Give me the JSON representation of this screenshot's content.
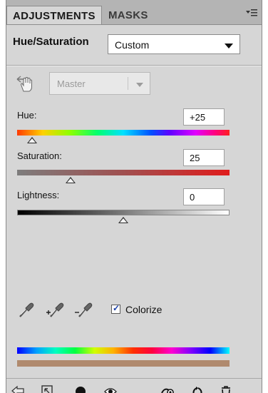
{
  "tabs": [
    {
      "label": "ADJUSTMENTS",
      "active": true
    },
    {
      "label": "MASKS",
      "active": false
    }
  ],
  "panel_menu_icon": "panel-menu-icon",
  "header": {
    "title": "Hue/Saturation",
    "preset": "Custom"
  },
  "channel": {
    "value": "Master",
    "enabled": false,
    "icon": "targeted-adjustment-hand-icon"
  },
  "sliders": {
    "hue": {
      "label": "Hue:",
      "value": "+25",
      "level": 0.07
    },
    "saturation": {
      "label": "Saturation:",
      "value": "25",
      "level": 0.25
    },
    "lightness": {
      "label": "Lightness:",
      "value": "0",
      "level": 0.5
    }
  },
  "eyedroppers": [
    "eyedropper-icon",
    "eyedropper-add-icon",
    "eyedropper-subtract-icon"
  ],
  "colorize": {
    "label": "Colorize",
    "checked": true
  },
  "colors": {
    "panel_bg": "#d6d6d6",
    "tab_bar": "#b4b4b4",
    "tint": "#b08a6e",
    "saturation_end": "#e01c1c"
  },
  "bottom_icons": [
    "return-icon",
    "clip-to-layer-icon",
    "visibility-circle-icon",
    "eye-icon",
    "view-previous-icon",
    "reset-icon",
    "trash-icon"
  ]
}
